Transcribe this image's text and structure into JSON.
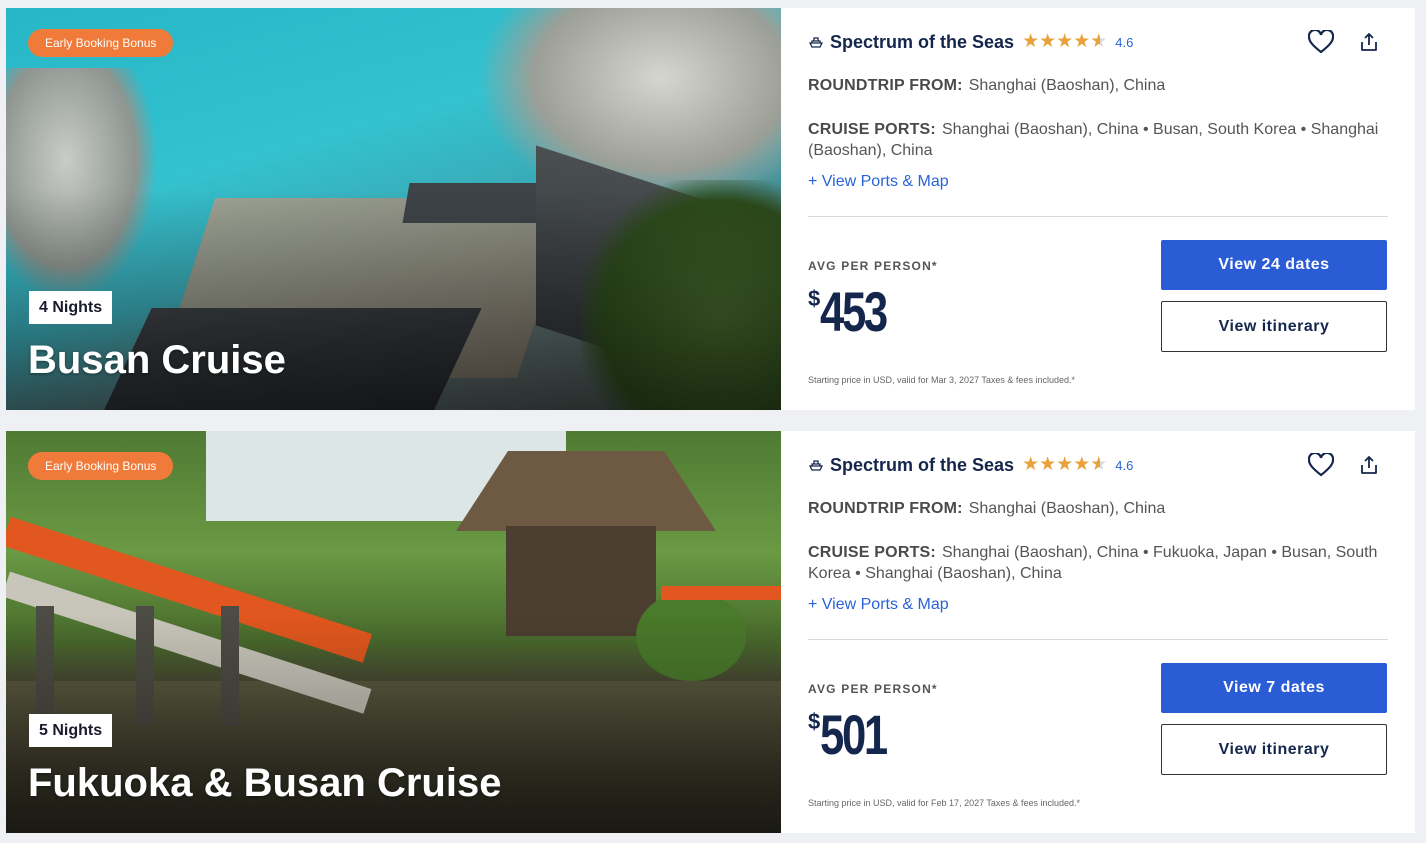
{
  "cruises": [
    {
      "bonus_label": "Early Booking Bonus",
      "nights": "4 Nights",
      "destination": "Busan Cruise",
      "ship": "Spectrum of the Seas",
      "rating": "4.6",
      "stars_value": 4.6,
      "roundtrip_label": "ROUNDTRIP FROM:",
      "roundtrip_value": "Shanghai (Baoshan), China",
      "ports_label": "CRUISE PORTS:",
      "ports_value": "Shanghai (Baoshan), China • Busan, South Korea • Shanghai (Baoshan), China",
      "view_ports_label": "+ View Ports & Map",
      "avg_label": "AVG PER PERSON*",
      "currency": "$",
      "price": "453",
      "fine_print": "Starting price in USD, valid for Mar 3, 2027 Taxes & fees included.*",
      "dates_button": "View 24 dates",
      "itinerary_button": "View itinerary"
    },
    {
      "bonus_label": "Early Booking Bonus",
      "nights": "5 Nights",
      "destination": "Fukuoka & Busan Cruise",
      "ship": "Spectrum of the Seas",
      "rating": "4.6",
      "stars_value": 4.6,
      "roundtrip_label": "ROUNDTRIP FROM:",
      "roundtrip_value": "Shanghai (Baoshan), China",
      "ports_label": "CRUISE PORTS:",
      "ports_value": "Shanghai (Baoshan), China • Fukuoka, Japan • Busan, South Korea • Shanghai (Baoshan), China",
      "view_ports_label": "+ View Ports & Map",
      "avg_label": "AVG PER PERSON*",
      "currency": "$",
      "price": "501",
      "fine_print": "Starting price in USD, valid for Feb 17, 2027 Taxes & fees included.*",
      "dates_button": "View 7 dates",
      "itinerary_button": "View itinerary"
    }
  ],
  "colors": {
    "primary": "#2a5cd6",
    "navy": "#15264d",
    "bonus": "#f07a3a",
    "star": "#e9a23b",
    "link": "#2a63d8"
  },
  "icons": [
    "ship-icon",
    "star-icon",
    "heart-icon",
    "share-icon"
  ]
}
